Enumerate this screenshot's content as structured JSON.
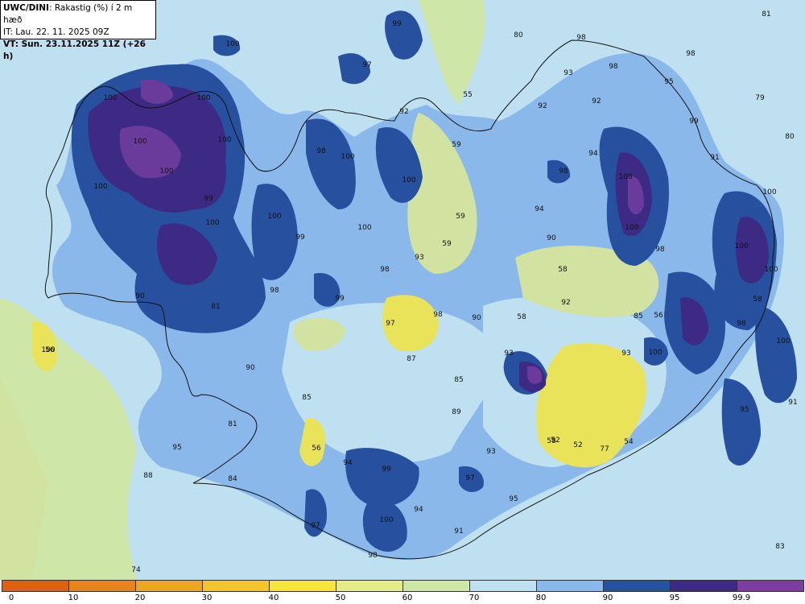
{
  "header": {
    "model": "UWC/DINI",
    "variable": ": Rakastig (%) í 2 m hæð",
    "init_time": "IT: Lau. 22. 11. 2025 09Z",
    "valid_time": "VT: Sun. 23.11.2025 11Z (+26 h)"
  },
  "colors": {
    "c50_60": "#d2e3a1",
    "c60_70": "#cfe6a9",
    "c70_80": "#bfe0f0",
    "c80_90": "#8bb8ea",
    "c90_95": "#27509f",
    "c95_999": "#3c2a85",
    "c999": "#6a3b9a",
    "yellow": "#e9e35a",
    "coast": "#111111"
  },
  "legend": {
    "bins": [
      {
        "from": "0",
        "color": "#e06012"
      },
      {
        "from": "10",
        "color": "#e8851a"
      },
      {
        "from": "20",
        "color": "#eda620"
      },
      {
        "from": "30",
        "color": "#f2c72b"
      },
      {
        "from": "40",
        "color": "#f5e73a"
      },
      {
        "from": "50",
        "color": "#e4ec86"
      },
      {
        "from": "60",
        "color": "#cfe6a9"
      },
      {
        "from": "70",
        "color": "#bfe0f0"
      },
      {
        "from": "80",
        "color": "#8bb8ea"
      },
      {
        "from": "90",
        "color": "#27509f"
      },
      {
        "from": "95",
        "color": "#3c2a85"
      },
      {
        "from": "99.9",
        "color": "#7b3e9c"
      }
    ],
    "tick_labels": [
      "0",
      "10",
      "20",
      "30",
      "40",
      "50",
      "60",
      "70",
      "80",
      "90",
      "95",
      "99.9"
    ]
  },
  "labels": [
    {
      "t": "81"
    },
    {
      "t": "99"
    },
    {
      "t": "80"
    },
    {
      "t": "100"
    },
    {
      "t": "97"
    },
    {
      "t": "98"
    },
    {
      "t": "98"
    },
    {
      "t": "98"
    },
    {
      "t": "93"
    },
    {
      "t": "55"
    },
    {
      "t": "92"
    },
    {
      "t": "92"
    },
    {
      "t": "95"
    },
    {
      "t": "79"
    },
    {
      "t": "100"
    },
    {
      "t": "100"
    },
    {
      "t": "100"
    },
    {
      "t": "92"
    },
    {
      "t": "59"
    },
    {
      "t": "99"
    },
    {
      "t": "80"
    },
    {
      "t": "100"
    },
    {
      "t": "98"
    },
    {
      "t": "100"
    },
    {
      "t": "94"
    },
    {
      "t": "91"
    },
    {
      "t": "100"
    },
    {
      "t": "98"
    },
    {
      "t": "100"
    },
    {
      "t": "100"
    },
    {
      "t": "99"
    },
    {
      "t": "100"
    },
    {
      "t": "94"
    },
    {
      "t": "59"
    },
    {
      "t": "100"
    },
    {
      "t": "100"
    },
    {
      "t": "99"
    },
    {
      "t": "100"
    },
    {
      "t": "90"
    },
    {
      "t": "100"
    },
    {
      "t": "100"
    },
    {
      "t": "59"
    },
    {
      "t": "98"
    },
    {
      "t": "93"
    },
    {
      "t": "98"
    },
    {
      "t": "58"
    },
    {
      "t": "100"
    },
    {
      "t": "100"
    },
    {
      "t": "98"
    },
    {
      "t": "99"
    },
    {
      "t": "92"
    },
    {
      "t": "98"
    },
    {
      "t": "97"
    },
    {
      "t": "90"
    },
    {
      "t": "58"
    },
    {
      "t": "56"
    },
    {
      "t": "58"
    },
    {
      "t": "90"
    },
    {
      "t": "81"
    },
    {
      "t": "98"
    },
    {
      "t": "100"
    },
    {
      "t": "100"
    },
    {
      "t": "93"
    },
    {
      "t": "93"
    },
    {
      "t": "56"
    },
    {
      "t": "87"
    },
    {
      "t": "100"
    },
    {
      "t": "52"
    },
    {
      "t": "90"
    },
    {
      "t": "85"
    },
    {
      "t": "85"
    },
    {
      "t": "85"
    },
    {
      "t": "91"
    },
    {
      "t": "89"
    },
    {
      "t": "81"
    },
    {
      "t": "58"
    },
    {
      "t": "95"
    },
    {
      "t": "95"
    },
    {
      "t": "56"
    },
    {
      "t": "52"
    },
    {
      "t": "54"
    },
    {
      "t": "77"
    },
    {
      "t": "93"
    },
    {
      "t": "94"
    },
    {
      "t": "99"
    },
    {
      "t": "97"
    },
    {
      "t": "88"
    },
    {
      "t": "84"
    },
    {
      "t": "95"
    },
    {
      "t": "94"
    },
    {
      "t": "97"
    },
    {
      "t": "100"
    },
    {
      "t": "91"
    },
    {
      "t": "98"
    },
    {
      "t": "74"
    },
    {
      "t": "83"
    }
  ]
}
